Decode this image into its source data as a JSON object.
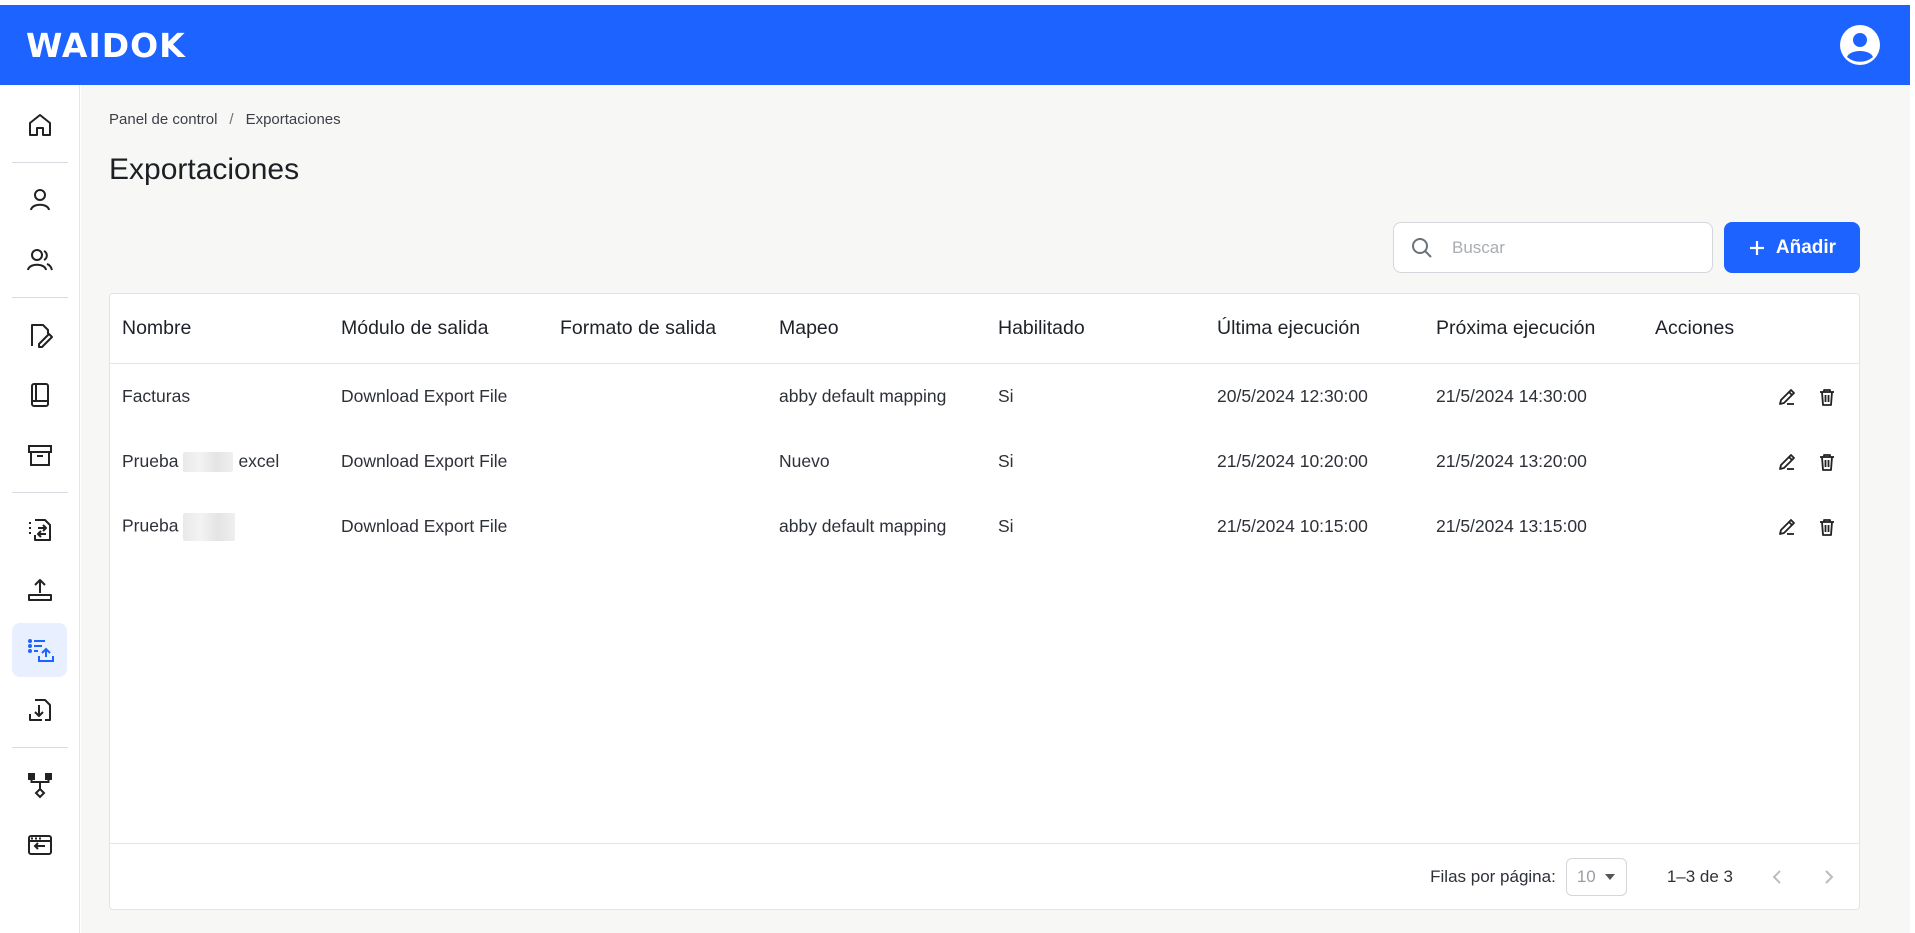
{
  "app": {
    "logo": "WAIDOK"
  },
  "breadcrumb": {
    "items": [
      "Panel de control",
      "Exportaciones"
    ],
    "separator": "/"
  },
  "page": {
    "title": "Exportaciones"
  },
  "toolbar": {
    "search_placeholder": "Buscar",
    "add_label": "Añadir"
  },
  "sidebar": {
    "items": [
      {
        "icon": "home-icon"
      },
      {
        "icon": "user-icon"
      },
      {
        "icon": "users-icon"
      },
      {
        "icon": "document-edit-icon"
      },
      {
        "icon": "book-icon"
      },
      {
        "icon": "archive-icon"
      },
      {
        "icon": "document-transfer-icon"
      },
      {
        "icon": "upload-icon"
      },
      {
        "icon": "list-export-icon",
        "active": true
      },
      {
        "icon": "document-download-icon"
      },
      {
        "icon": "workflow-icon"
      },
      {
        "icon": "window-return-icon"
      }
    ]
  },
  "table": {
    "columns": [
      "Nombre",
      "Módulo de salida",
      "Formato de salida",
      "Mapeo",
      "Habilitado",
      "Última ejecución",
      "Próxima ejecución",
      "Acciones"
    ],
    "rows": [
      {
        "nombre": "Facturas",
        "nombre_suffix": "",
        "modulo": "Download Export File",
        "formato": "",
        "mapeo": "abby default mapping",
        "habilitado": "Si",
        "ultima": "20/5/2024 12:30:00",
        "proxima": "21/5/2024 14:30:00"
      },
      {
        "nombre": "Prueba",
        "nombre_suffix": "excel",
        "modulo": "Download Export File",
        "formato": "",
        "mapeo": "Nuevo",
        "habilitado": "Si",
        "ultima": "21/5/2024 10:20:00",
        "proxima": "21/5/2024 13:20:00"
      },
      {
        "nombre": "Prueba",
        "nombre_suffix": "",
        "modulo": "Download Export File",
        "formato": "",
        "mapeo": "abby default mapping",
        "habilitado": "Si",
        "ultima": "21/5/2024 10:15:00",
        "proxima": "21/5/2024 13:15:00"
      }
    ]
  },
  "pagination": {
    "rows_per_page_label": "Filas por página:",
    "rows_per_page_value": "10",
    "range": "1–3 de 3"
  },
  "colors": {
    "brand": "#1d63ff",
    "active_bg": "#e8f0ff"
  }
}
